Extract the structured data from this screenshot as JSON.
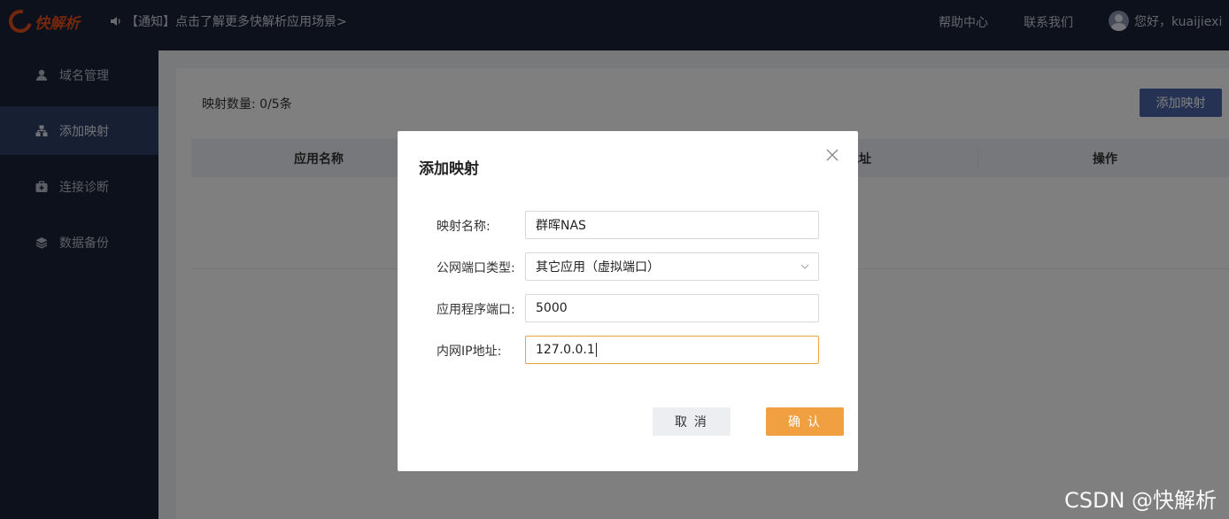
{
  "topbar": {
    "logo_text": "快解析",
    "notice": "【通知】点击了解更多快解析应用场景>",
    "help": "帮助中心",
    "contact": "联系我们",
    "user_greeting": "您好，kuaijiexi"
  },
  "sidebar": {
    "items": [
      {
        "label": "域名管理",
        "icon": "user-icon"
      },
      {
        "label": "添加映射",
        "icon": "sitemap-icon"
      },
      {
        "label": "连接诊断",
        "icon": "medkit-icon"
      },
      {
        "label": "数据备份",
        "icon": "layers-icon"
      }
    ]
  },
  "content": {
    "count_label": "映射数量:  0/5条",
    "add_button": "添加映射",
    "columns": {
      "app_name": "应用名称",
      "address": "地址",
      "actions": "操作"
    }
  },
  "modal": {
    "title": "添加映射",
    "fields": {
      "name_label": "映射名称:",
      "name_value": "群晖NAS",
      "port_type_label": "公网端口类型:",
      "port_type_value": "其它应用（虚拟端口）",
      "app_port_label": "应用程序端口:",
      "app_port_value": "5000",
      "ip_label": "内网IP地址:",
      "ip_value": "127.0.0.1"
    },
    "cancel": "取 消",
    "confirm": "确 认"
  },
  "watermark": "CSDN @快解析",
  "colors": {
    "topbar_bg": "#1a2238",
    "sidebar_active": "#2f3e66",
    "primary": "#4a64a8",
    "accent": "#f0a040",
    "logo": "#e94e1b"
  }
}
